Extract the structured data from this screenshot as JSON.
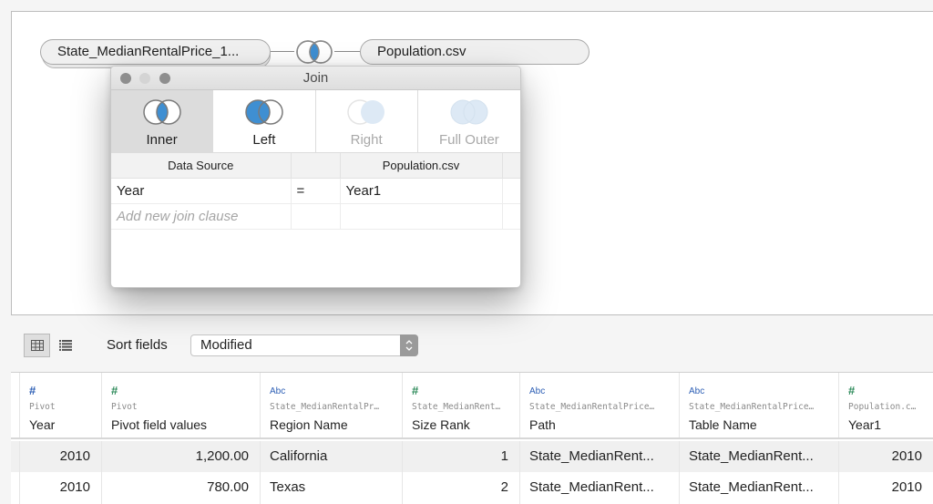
{
  "canvas": {
    "left_table": "State_MedianRentalPrice_1...",
    "right_table": "Population.csv",
    "join_node_icon": "left-join-venn-icon"
  },
  "dialog": {
    "title": "Join",
    "join_types": [
      {
        "label": "Inner",
        "state": "hover",
        "icon": "inner-join-venn-icon"
      },
      {
        "label": "Left",
        "state": "selected",
        "icon": "left-join-venn-icon"
      },
      {
        "label": "Right",
        "state": "disabled",
        "icon": "right-join-venn-icon"
      },
      {
        "label": "Full Outer",
        "state": "disabled",
        "icon": "full-outer-join-venn-icon"
      }
    ],
    "clauses": {
      "headers": {
        "left": "Data Source",
        "operator": "",
        "right": "Population.csv"
      },
      "rows": [
        {
          "left": "Year",
          "operator": "=",
          "right": "Year1"
        }
      ],
      "add_placeholder": "Add new join clause"
    }
  },
  "toolbar": {
    "grid_view_icon": "grid-view-icon",
    "list_view_icon": "list-view-icon",
    "sort_label": "Sort fields",
    "sort_value": "Modified"
  },
  "grid": {
    "columns": [
      {
        "type": "#",
        "type_color": "blue",
        "source": "Pivot",
        "name": "Year"
      },
      {
        "type": "#",
        "type_color": "green",
        "source": "Pivot",
        "name": "Pivot field values"
      },
      {
        "type": "Abc",
        "type_color": "blue",
        "source": "State_MedianRentalPr…",
        "name": "Region Name"
      },
      {
        "type": "#",
        "type_color": "green",
        "source": "State_MedianRent…",
        "name": "Size Rank"
      },
      {
        "type": "Abc",
        "type_color": "blue",
        "source": "State_MedianRentalPrice…",
        "name": "Path"
      },
      {
        "type": "Abc",
        "type_color": "blue",
        "source": "State_MedianRentalPrice…",
        "name": "Table Name"
      },
      {
        "type": "#",
        "type_color": "green",
        "source": "Population.c…",
        "name": "Year1"
      }
    ],
    "rows": [
      [
        "2010",
        "1,200.00",
        "California",
        "1",
        "State_MedianRent...",
        "State_MedianRent...",
        "2010"
      ],
      [
        "2010",
        "780.00",
        "Texas",
        "2",
        "State_MedianRent...",
        "State_MedianRent...",
        "2010"
      ]
    ]
  },
  "colors": {
    "accent_blue": "#3f8fd2",
    "disabled_fill": "#dde9f5",
    "type_blue": "#2d5fb5",
    "type_green": "#2d8a5a"
  }
}
